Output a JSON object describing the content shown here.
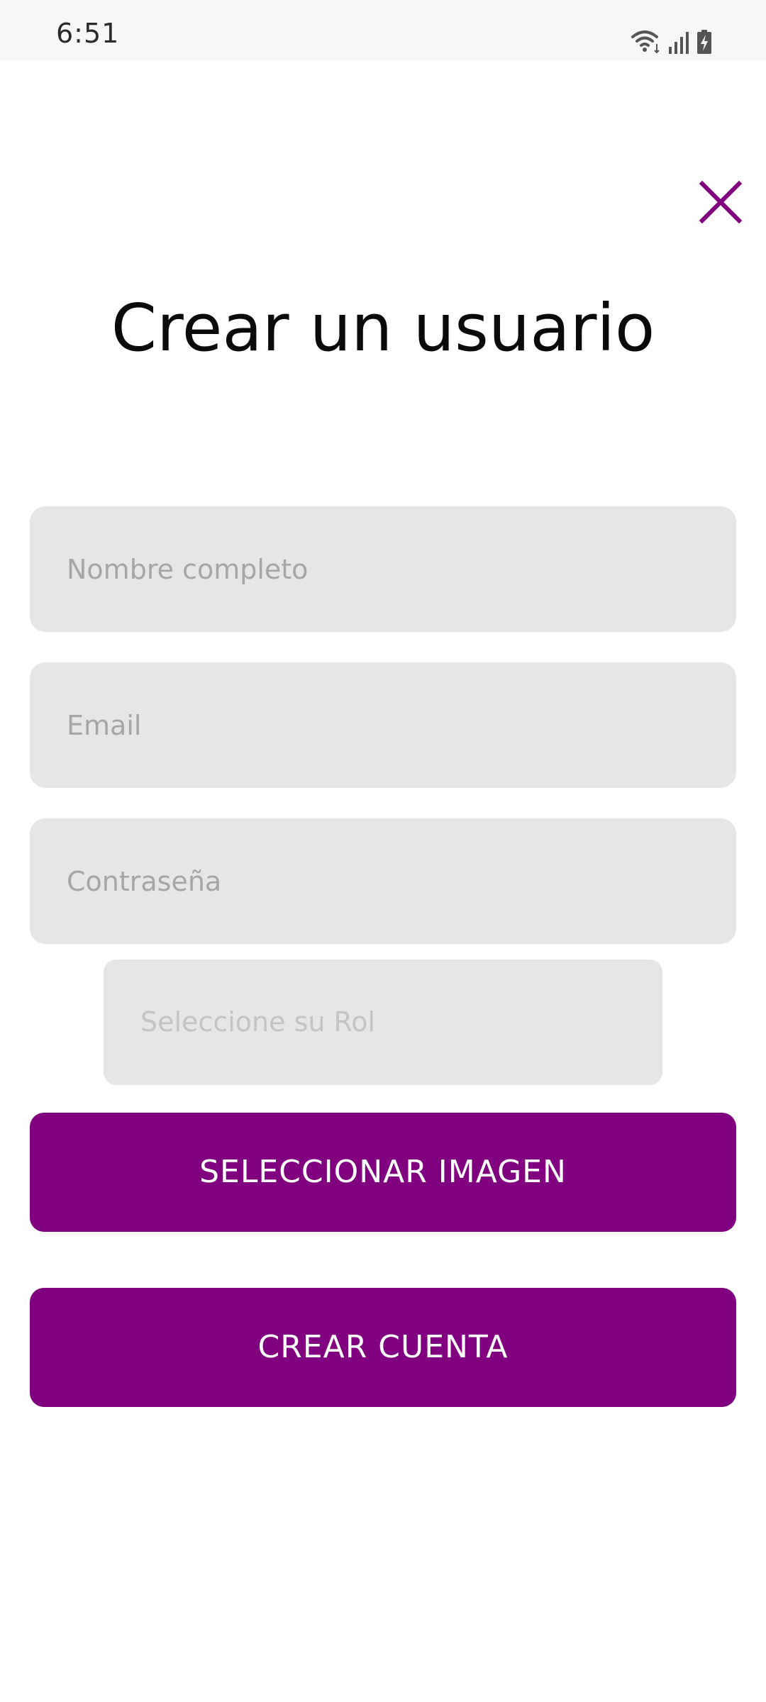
{
  "status_bar": {
    "time": "6:51",
    "icons": [
      "wifi-icon",
      "signal-icon",
      "battery-charging-icon"
    ]
  },
  "colors": {
    "accent": "#800080",
    "field_bg": "#e6e6e6",
    "placeholder": "#a6a6a6"
  },
  "header": {
    "close_icon": "close-icon"
  },
  "form": {
    "title": "Crear un usuario",
    "name_placeholder": "Nombre completo",
    "email_placeholder": "Email",
    "password_placeholder": "Contraseña",
    "role_placeholder": "Seleccione su Rol",
    "select_image_label": "SELECCIONAR IMAGEN",
    "create_account_label": "CREAR CUENTA"
  }
}
